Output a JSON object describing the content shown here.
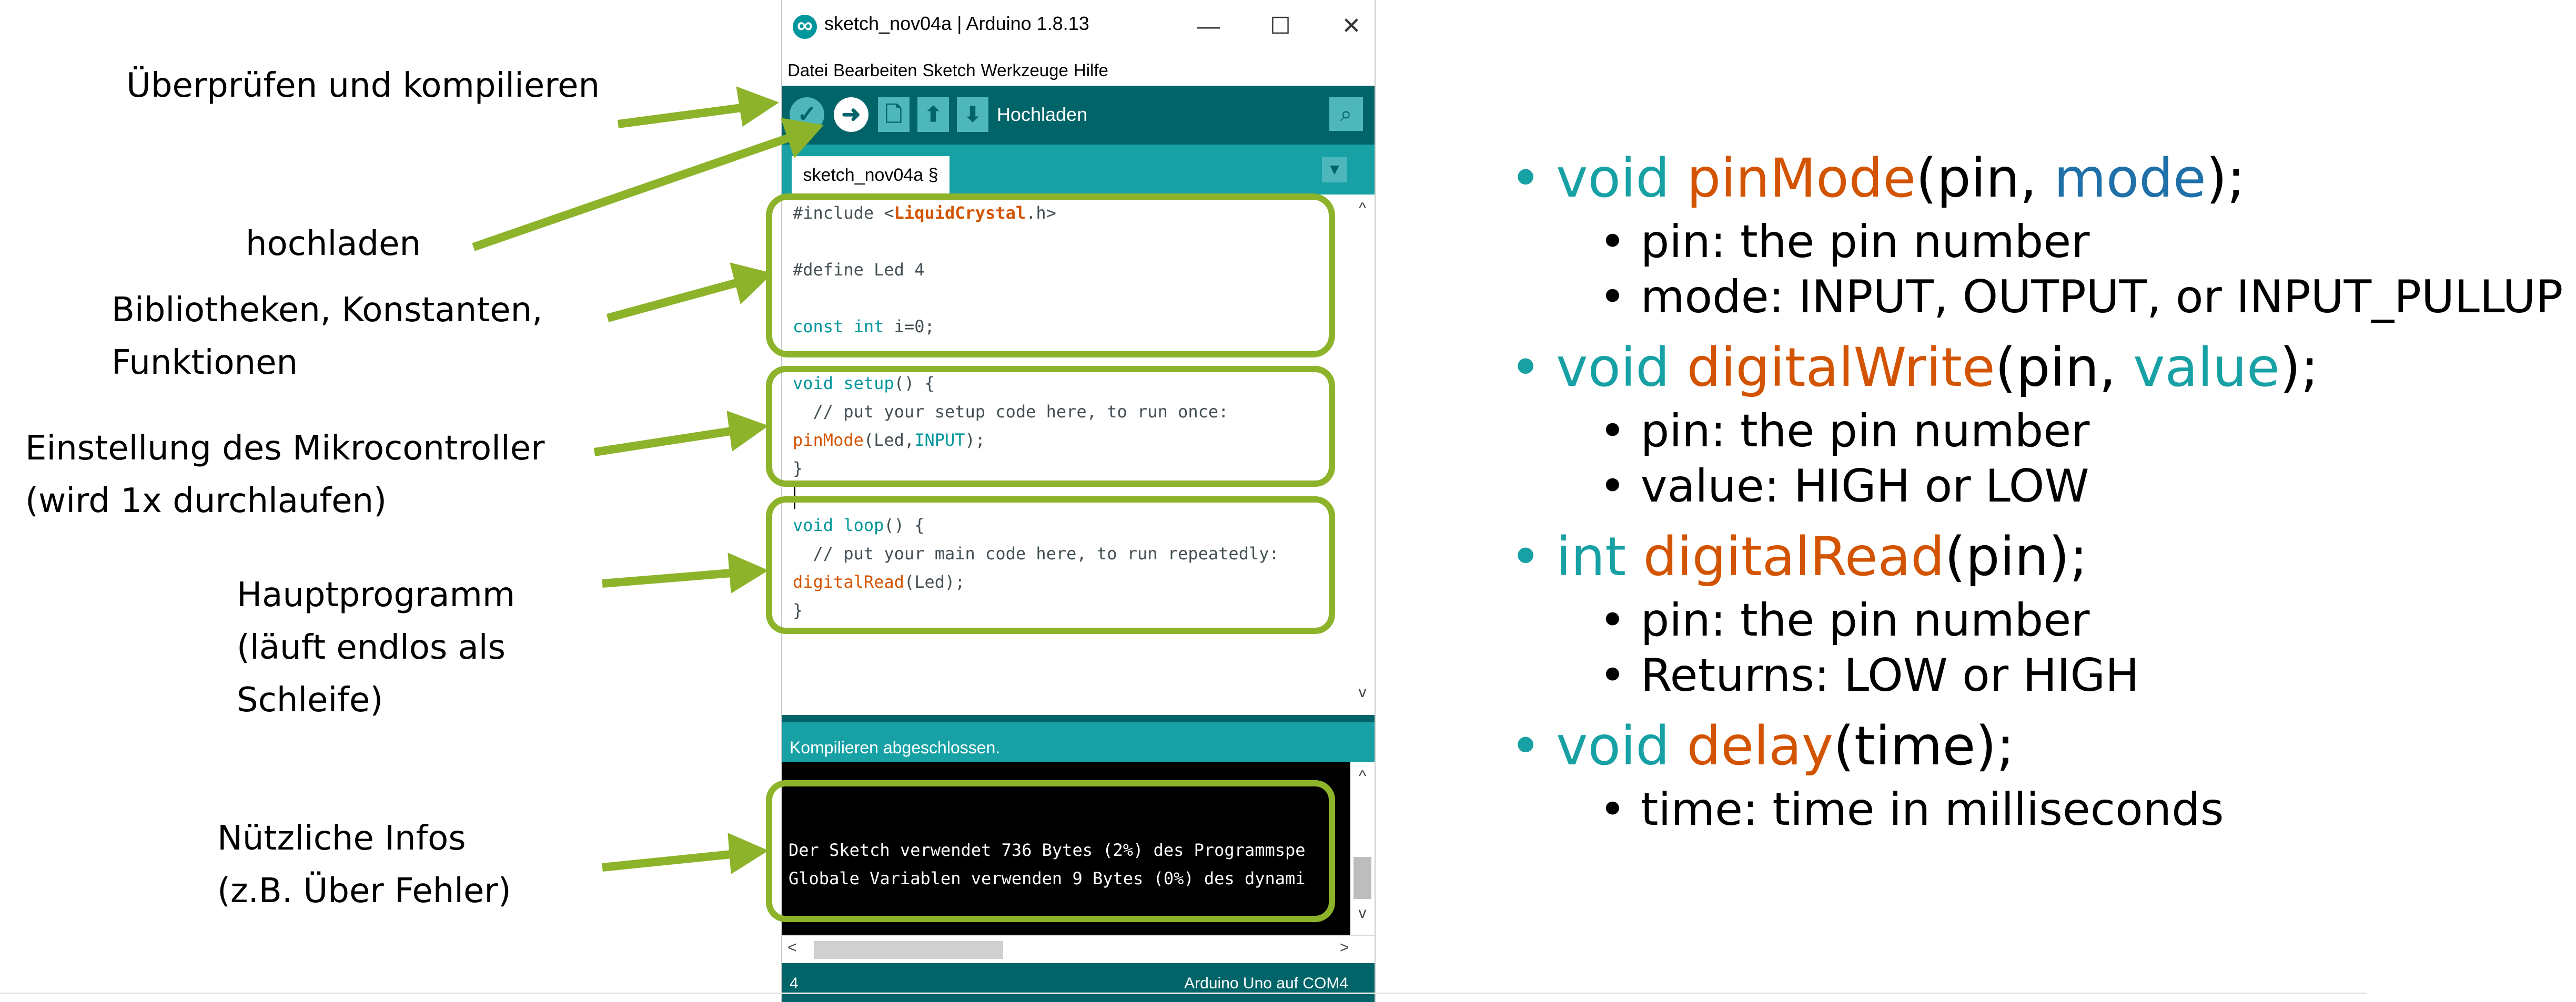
{
  "window": {
    "title": "sketch_nov04a | Arduino 1.8.13",
    "controls": {
      "minimize": "—",
      "maximize": "☐",
      "close": "✕"
    }
  },
  "menu": [
    "Datei",
    "Bearbeiten",
    "Sketch",
    "Werkzeuge",
    "Hilfe"
  ],
  "toolbar": {
    "verify_glyph": "✓",
    "upload_glyph": "➜",
    "new_glyph": "🗋",
    "open_glyph": "⬆",
    "save_glyph": "⬇",
    "upload_label": "Hochladen",
    "serial_glyph": "⌕"
  },
  "tab": {
    "label": "sketch_nov04a §",
    "menu_glyph": "▼"
  },
  "code": {
    "l1_pre": "#include <",
    "l1_lib": "LiquidCrystal",
    "l1_post": ".h>",
    "l2": "#define Led 4",
    "l3_kw": "const int",
    "l3_rest": " i=0;",
    "l4_kw": "void",
    "l4_fn": " setup",
    "l4_rest": "() {",
    "l5": "  // put your setup code here, to run once:",
    "l6_fn": "pinMode",
    "l6_mid": "(Led,",
    "l6_const": "INPUT",
    "l6_end": ");",
    "l7": "}",
    "l8_kw": "void",
    "l8_fn": " loop",
    "l8_rest": "() {",
    "l9": "  // put your main code here, to run repeatedly:",
    "l10_fn": "digitalRead",
    "l10_rest": "(Led);",
    "l11": "}"
  },
  "scroll": {
    "up": "^",
    "down": "v",
    "left": "<",
    "right": ">"
  },
  "status": "Kompilieren abgeschlossen.",
  "console": {
    "line1": "Der Sketch verwendet 736 Bytes (2%) des Programmspe",
    "line2": "Globale Variablen verwenden 9 Bytes (0%) des dynami"
  },
  "footer": {
    "line": "4",
    "board": "Arduino Uno auf COM4"
  },
  "annotations": {
    "verify": "Überprüfen und kompilieren",
    "upload": "hochladen",
    "libs_1": "Bibliotheken, Konstanten,",
    "libs_2": "Funktionen",
    "setup_1": "Einstellung des Mikrocontroller",
    "setup_2": "(wird 1x durchlaufen)",
    "main_1": "Hauptprogramm",
    "main_2": "(läuft endlos als",
    "main_3": "Schleife)",
    "info_1": "Nützliche Infos",
    "info_2": "(z.B. Über Fehler)"
  },
  "reference": {
    "bullet1": "•",
    "bullet2": "•",
    "f1_ret": "void",
    "f1_name": "pinMode",
    "f1_open": "(pin, ",
    "f1_arg": "mode",
    "f1_close": ");",
    "f1_d1": "pin: the pin number",
    "f1_d2": "mode: INPUT, OUTPUT, or INPUT_PULLUP",
    "f2_ret": "void",
    "f2_name": "digitalWrite",
    "f2_open": "(pin, ",
    "f2_arg": "value",
    "f2_close": ");",
    "f2_d1": "pin: the pin number",
    "f2_d2": "value: HIGH or LOW",
    "f3_ret": "int",
    "f3_name": "digitalRead",
    "f3_rest": "(pin);",
    "f3_d1": "pin: the pin number",
    "f3_d2": "Returns: LOW or HIGH",
    "f4_ret": "void",
    "f4_name": "delay",
    "f4_rest": "(time);",
    "f4_d1": "time: time in milliseconds"
  },
  "colors": {
    "highlight_box": "#8db32a",
    "toolbar": "#006468",
    "tabbar": "#17a1a5",
    "keyword": "#00979c",
    "function": "#d35400",
    "arg_blue": "#1f6fa8"
  }
}
